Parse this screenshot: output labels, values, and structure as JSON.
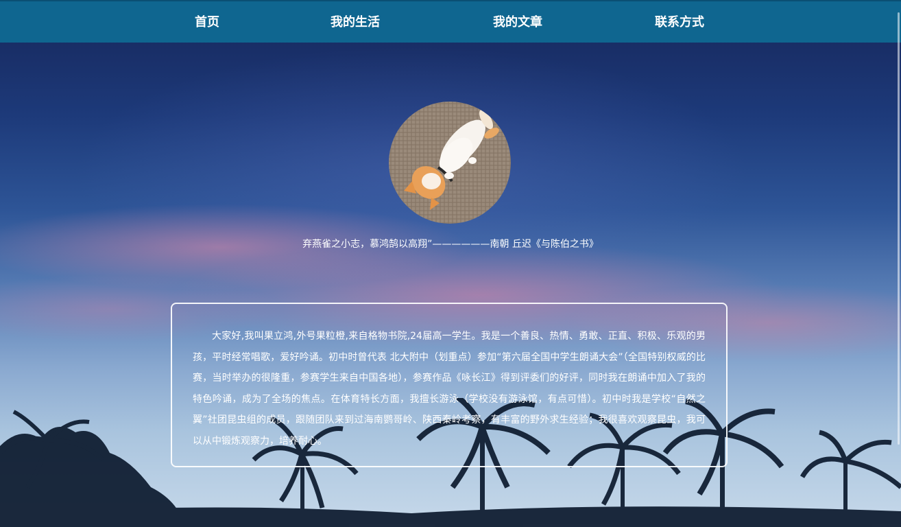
{
  "nav": {
    "items": [
      {
        "label": "首页"
      },
      {
        "label": "我的生活"
      },
      {
        "label": "我的文章"
      },
      {
        "label": "联系方式"
      }
    ],
    "background_color": "#0f6690"
  },
  "hero": {
    "avatar_description": "cat-sleeping-avatar",
    "quote": "弃燕雀之小志，慕鸿鹄以高翔”——————南朝 丘迟《与陈伯之书》"
  },
  "intro": {
    "text": "大家好,我叫果立鸿,外号果粒橙,来自格物书院,24届高一学生。我是一个善良、热情、勇敢、正直、积极、乐观的男孩，平时经常唱歌，爱好吟诵。初中时曾代表 北大附中（划重点）参加“第六届全国中学生朗诵大会”（全国特别权威的比赛，当时举办的很隆重，参赛学生来自中国各地），参赛作品《咏长江》得到评委们的好评，同时我在朗诵中加入了我的特色吟诵，成为了全场的焦点。在体育特长方面，我擅长游泳（学校没有游泳馆，有点可惜）。初中时我是学校“自然之翼”社团昆虫组的成员，跟随团队来到过海南鹦哥岭、陕西秦岭考察，有丰富的野外求生经验；我很喜欢观察昆虫，我可以从中锻炼观察力，培养耐心。"
  }
}
